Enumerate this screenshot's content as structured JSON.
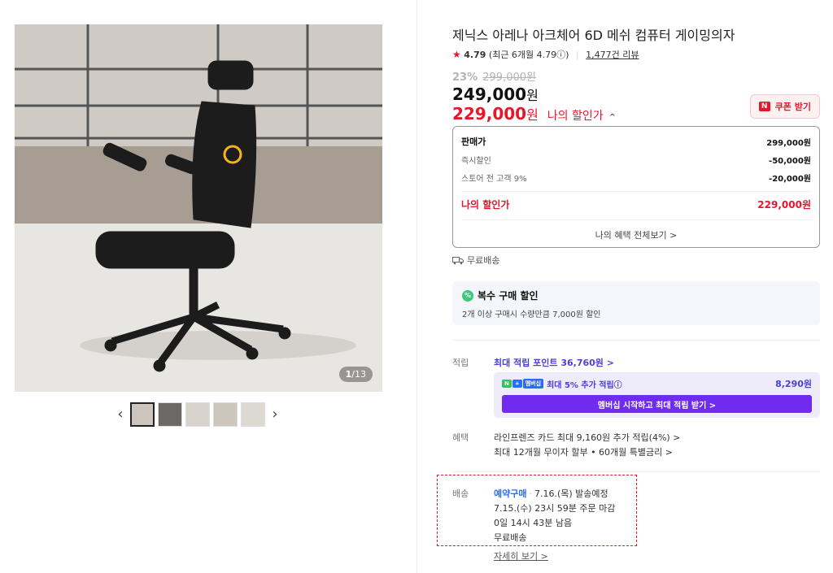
{
  "gallery": {
    "counter_current": "1",
    "counter_total": "/13",
    "prev_arrow": "‹",
    "next_arrow": "›"
  },
  "product": {
    "title": "제닉스 아레나 아크체어 6D 메쉬 컴퓨터 게이밍의자",
    "rating_star": "★",
    "rating": "4.79",
    "rating_recent": "(최근 6개월 4.79ⓘ)",
    "reviews": "1,477건 리뷰",
    "discount_rate": "23%",
    "original_price": "299,000",
    "original_unit": "원",
    "sale_price": "249,000",
    "sale_unit": "원",
    "my_price": "229,000",
    "my_unit": "원",
    "my_label": "나의 할인가",
    "my_caret": "^",
    "coupon_badge": "N",
    "coupon_label": "쿠폰 받기"
  },
  "breakdown": {
    "rows": [
      {
        "label": "판매가",
        "value": "299,000원"
      },
      {
        "label": "즉시할인",
        "value": "-50,000원"
      },
      {
        "label": "스토어 전 고객 9%",
        "value": "-20,000원"
      }
    ],
    "final_label": "나의 할인가",
    "final_value": "229,000원",
    "footer": "나의 혜택 전체보기 >"
  },
  "free_shipping": "무료배송",
  "multibuy": {
    "icon": "%",
    "title": "복수 구매 할인",
    "desc": "2개 이상 구매시 수량만큼 7,000원 할인"
  },
  "points": {
    "label": "적립",
    "link": "최대 적립 포인트 36,760원 >",
    "membership_badge_n": "N",
    "membership_badge_plus": "+",
    "membership_badge": "멤버십",
    "membership_text": "최대 5% 추가 적립ⓘ",
    "membership_value": "8,290원",
    "membership_button": "멤버십 시작하고 최대 적립 받기 >"
  },
  "benefits": {
    "label": "혜택",
    "line1": "라인프렌즈 카드 최대 9,160원 추가 적립(4%) >",
    "line2": "최대 12개월 무이자 할부 • 60개월 특별금리 >"
  },
  "delivery": {
    "label": "배송",
    "reserve": "예약구매",
    "dot": "·",
    "ship_date": "7.16.(목) 발송예정",
    "cutoff": "7.15.(수) 23시 59분 주문 마감",
    "remaining": "0일 14시 43분 남음",
    "fee": "무료배송",
    "detail": "자세히 보기 >"
  }
}
